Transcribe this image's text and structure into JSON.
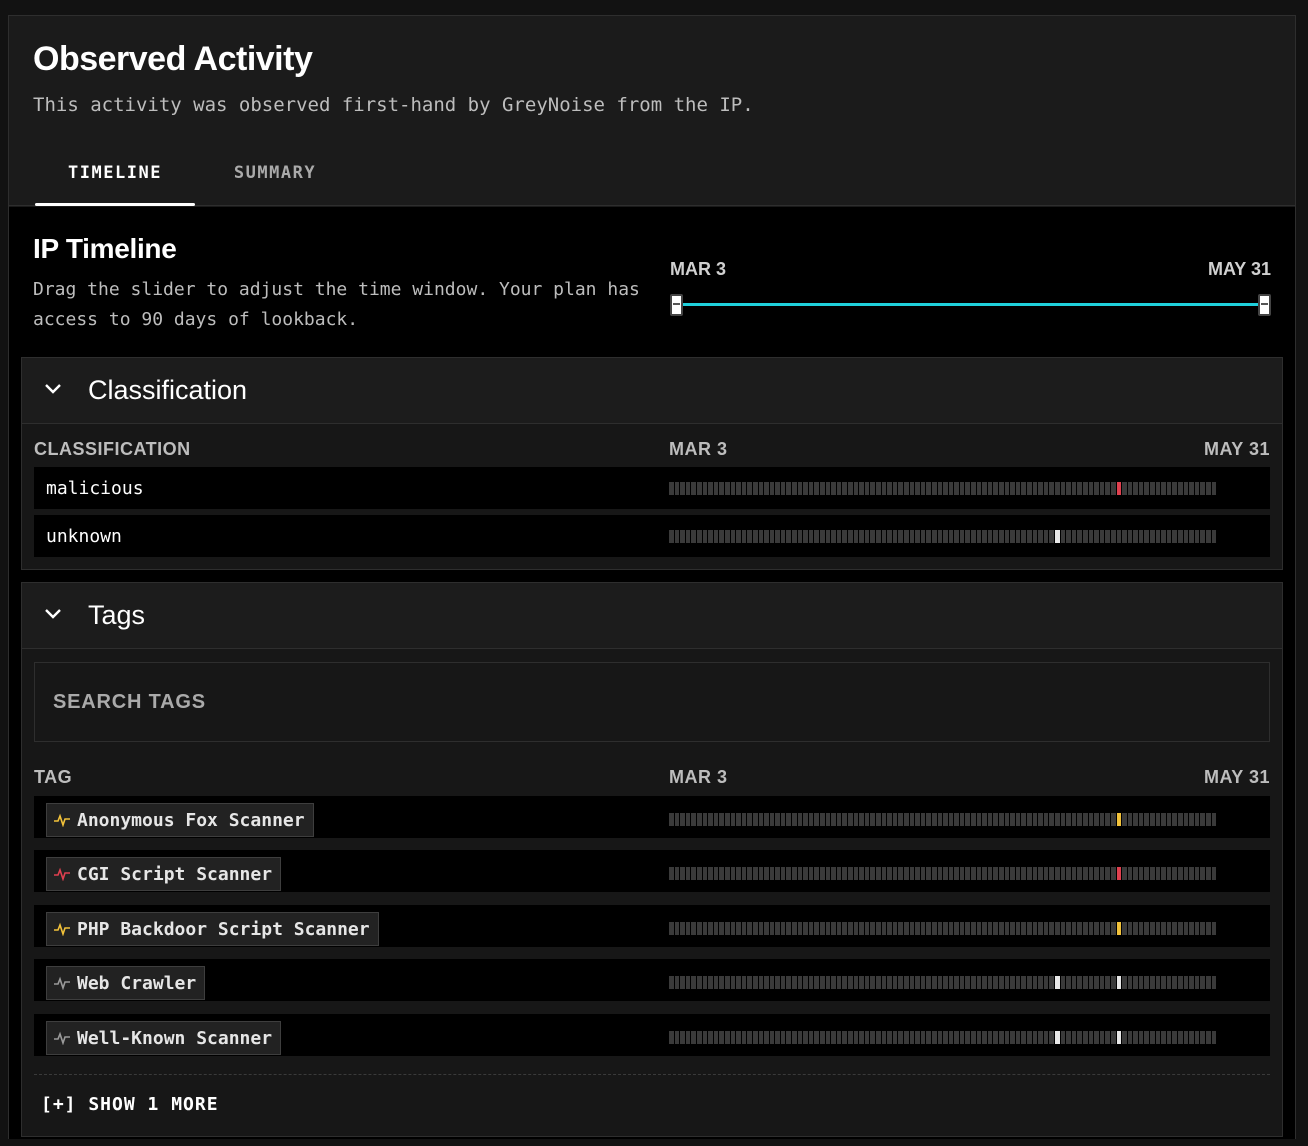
{
  "header": {
    "title": "Observed Activity",
    "subtitle": "This activity was observed first-hand by GreyNoise from the IP.",
    "tabs": [
      {
        "label": "TIMELINE",
        "active": true
      },
      {
        "label": "SUMMARY",
        "active": false
      }
    ]
  },
  "timeline": {
    "title": "IP Timeline",
    "description": "Drag the slider to adjust the time window. Your plan has access to 90 days of lookback.",
    "slider": {
      "start_label": "MAR 3",
      "end_label": "MAY 31",
      "range": [
        0,
        1
      ]
    }
  },
  "classification": {
    "title": "Classification",
    "column_label": "CLASSIFICATION",
    "start_label": "MAR 3",
    "end_label": "MAY 31",
    "rows": [
      {
        "label": "malicious",
        "color": "red",
        "active_days": [
          88
        ]
      },
      {
        "label": "unknown",
        "color": "white",
        "active_days": [
          77
        ]
      }
    ]
  },
  "tags": {
    "title": "Tags",
    "search_placeholder": "SEARCH TAGS",
    "column_label": "TAG",
    "start_label": "MAR 3",
    "end_label": "MAY 31",
    "rows": [
      {
        "label": "Anonymous Fox Scanner",
        "intent": "suspicious",
        "icon": "pulse-icon",
        "color": "yellow",
        "active_days": [
          88
        ]
      },
      {
        "label": "CGI Script Scanner",
        "intent": "malicious",
        "icon": "pulse-icon",
        "color": "red",
        "active_days": [
          88
        ]
      },
      {
        "label": "PHP Backdoor Script Scanner",
        "intent": "suspicious",
        "icon": "pulse-icon",
        "color": "yellow",
        "active_days": [
          88
        ]
      },
      {
        "label": "Web Crawler",
        "intent": "benign",
        "icon": "pulse-icon",
        "color": "white",
        "active_days": [
          77,
          88
        ]
      },
      {
        "label": "Well-Known Scanner",
        "intent": "benign",
        "icon": "pulse-icon",
        "color": "white",
        "active_days": [
          77,
          88
        ]
      }
    ],
    "show_more_label": "[+] SHOW 1 MORE"
  },
  "colors": {
    "accent": "#1fd0dc",
    "malicious": "#e0404f",
    "suspicious": "#f2c23a",
    "benign": "#9a9a9a",
    "inactive_bar": "#3a3a3a"
  }
}
